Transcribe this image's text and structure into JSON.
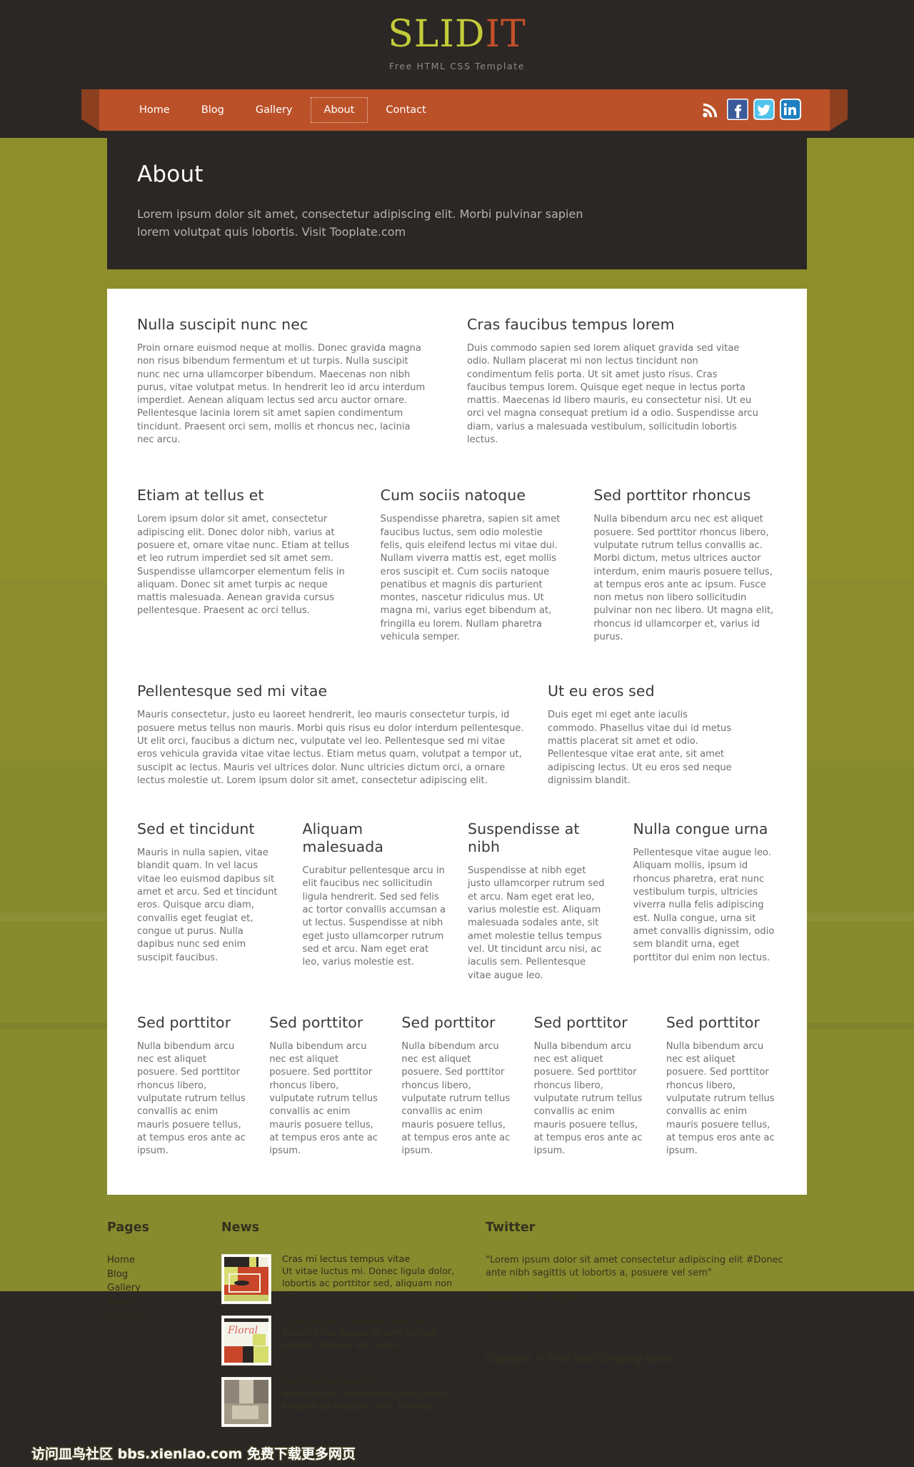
{
  "header": {
    "logo_part_a": "SLID",
    "logo_part_b": "IT",
    "tagline": "Free HTML CSS Template"
  },
  "nav": {
    "items": [
      {
        "label": "Home",
        "active": false
      },
      {
        "label": "Blog",
        "active": false
      },
      {
        "label": "Gallery",
        "active": false
      },
      {
        "label": "About",
        "active": true
      },
      {
        "label": "Contact",
        "active": false
      }
    ],
    "social": [
      {
        "name": "rss-icon",
        "label": "RSS"
      },
      {
        "name": "facebook-icon",
        "label": "Facebook"
      },
      {
        "name": "twitter-icon",
        "label": "Twitter"
      },
      {
        "name": "linkedin-icon",
        "label": "LinkedIn"
      }
    ]
  },
  "intro": {
    "title": "About",
    "text": "Lorem ipsum dolor sit amet, consectetur adipiscing elit. Morbi pulvinar sapien lorem volutpat quis lobortis. Visit Tooplate.com"
  },
  "row1": [
    {
      "heading": "Nulla suscipit nunc nec",
      "body": "Proin ornare euismod neque at mollis. Donec gravida magna non risus bibendum fermentum et ut turpis. Nulla suscipit nunc nec urna ullamcorper bibendum. Maecenas non nibh purus, vitae volutpat metus. In hendrerit leo id arcu interdum imperdiet. Aenean aliquam lectus sed arcu auctor ornare. Pellentesque lacinia lorem sit amet sapien condimentum tincidunt. Praesent orci sem, mollis et rhoncus nec, lacinia nec arcu."
    },
    {
      "heading": "Cras faucibus tempus lorem",
      "body": "Duis commodo sapien sed lorem aliquet gravida sed vitae odio. Nullam placerat mi non lectus tincidunt non condimentum felis porta. Ut sit amet justo risus. Cras faucibus tempus lorem. Quisque eget neque in lectus porta mattis. Maecenas id libero mauris, eu consectetur nisi. Ut eu orci vel magna consequat pretium id a odio. Suspendisse arcu diam, varius a malesuada vestibulum, sollicitudin lobortis lectus."
    }
  ],
  "row2": [
    {
      "heading": "Etiam at tellus et",
      "body": "Lorem ipsum dolor sit amet, consectetur adipiscing elit. Donec dolor nibh, varius at posuere et, ornare vitae nunc. Etiam at tellus et leo rutrum imperdiet sed sit amet sem. Suspendisse ullamcorper elementum felis in aliquam. Donec sit amet turpis ac neque mattis malesuada. Aenean gravida cursus pellentesque. Praesent ac orci tellus."
    },
    {
      "heading": "Cum sociis natoque",
      "body": "Suspendisse pharetra, sapien sit amet faucibus luctus, sem odio molestie felis, quis eleifend lectus mi vitae dui. Nullam viverra mattis est, eget mollis eros suscipit et. Cum sociis natoque penatibus et magnis dis parturient montes, nascetur ridiculus mus. Ut magna mi, varius eget bibendum at, fringilla eu lorem. Nullam pharetra vehicula semper."
    },
    {
      "heading": "Sed porttitor rhoncus",
      "body": "Nulla bibendum arcu nec est aliquet posuere. Sed porttitor rhoncus libero, vulputate rutrum tellus convallis ac. Morbi dictum, metus ultrices auctor interdum, enim mauris posuere tellus, at tempus eros ante ac ipsum. Fusce non metus non libero sollicitudin pulvinar non nec libero. Ut magna elit, rhoncus id ullamcorper et, varius id purus."
    }
  ],
  "row3": [
    {
      "heading": "Pellentesque sed mi vitae",
      "body": "Mauris consectetur, justo eu laoreet hendrerit, leo mauris consectetur turpis, id posuere metus tellus non mauris. Morbi quis risus eu dolor interdum pellentesque. Ut elit orci, faucibus a dictum nec, vulputate vel leo. Pellentesque sed mi vitae eros vehicula gravida vitae vitae lectus. Etiam metus quam, volutpat a tempor ut, suscipit ac lectus. Mauris vel ultrices dolor. Nunc ultricies dictum orci, a ornare lectus molestie ut. Lorem ipsum dolor sit amet, consectetur adipiscing elit."
    },
    {
      "heading": "Ut eu eros sed",
      "body": "Duis eget mi eget ante iaculis commodo. Phasellus vitae dui id metus mattis placerat sit amet et odio. Pellentesque vitae erat ante, sit amet adipiscing lectus. Ut eu eros sed neque dignissim blandit."
    }
  ],
  "row4": [
    {
      "heading": "Sed et tincidunt",
      "body": "Mauris in nulla sapien, vitae blandit quam. In vel lacus vitae leo euismod dapibus sit amet et arcu. Sed et tincidunt eros. Quisque arcu diam, convallis eget feugiat et, congue ut purus. Nulla dapibus nunc sed enim suscipit faucibus."
    },
    {
      "heading": "Aliquam malesuada",
      "body": "Curabitur pellentesque arcu in elit faucibus nec sollicitudin ligula hendrerit. Sed sed felis ac tortor convallis accumsan a ut lectus. Suspendisse at nibh eget justo ullamcorper rutrum sed et arcu. Nam eget erat leo, varius molestie est."
    },
    {
      "heading": "Suspendisse at nibh",
      "body": "Suspendisse at nibh eget justo ullamcorper rutrum sed et arcu. Nam eget erat leo, varius molestie est. Aliquam malesuada sodales ante, sit amet molestie tellus tempus vel. Ut tincidunt arcu nisi, ac iaculis sem. Pellentesque vitae augue leo."
    },
    {
      "heading": "Nulla congue urna",
      "body": "Pellentesque vitae augue leo. Aliquam mollis, ipsum id rhoncus pharetra, erat nunc vestibulum turpis, ultricies viverra nulla felis adipiscing est. Nulla congue, urna sit amet convallis dignissim, odio sem blandit urna, eget porttitor dui enim non lectus."
    }
  ],
  "row5": [
    {
      "heading": "Sed porttitor",
      "body": "Nulla bibendum arcu nec est aliquet posuere. Sed porttitor rhoncus libero, vulputate rutrum tellus convallis ac enim mauris posuere tellus, at tempus eros ante ac ipsum."
    },
    {
      "heading": "Sed porttitor",
      "body": "Nulla bibendum arcu nec est aliquet posuere. Sed porttitor rhoncus libero, vulputate rutrum tellus convallis ac enim mauris posuere tellus, at tempus eros ante ac ipsum."
    },
    {
      "heading": "Sed porttitor",
      "body": "Nulla bibendum arcu nec est aliquet posuere. Sed porttitor rhoncus libero, vulputate rutrum tellus convallis ac enim mauris posuere tellus, at tempus eros ante ac ipsum."
    },
    {
      "heading": "Sed porttitor",
      "body": "Nulla bibendum arcu nec est aliquet posuere. Sed porttitor rhoncus libero, vulputate rutrum tellus convallis ac enim mauris posuere tellus, at tempus eros ante ac ipsum."
    },
    {
      "heading": "Sed porttitor",
      "body": "Nulla bibendum arcu nec est aliquet posuere. Sed porttitor rhoncus libero, vulputate rutrum tellus convallis ac enim mauris posuere tellus, at tempus eros ante ac ipsum."
    }
  ],
  "footer": {
    "pages_title": "Pages",
    "pages": [
      {
        "label": "Home"
      },
      {
        "label": "Blog"
      },
      {
        "label": "Gallery"
      },
      {
        "label": "About"
      },
      {
        "label": "Contact"
      }
    ],
    "news_title": "News",
    "news": [
      {
        "title": "Cras mi lectus tempus vitae",
        "text": "Ut vitae luctus mi. Donec ligula dolor, lobortis ac porttitor sed, aliquam non orci."
      },
      {
        "title": "Cras dignissim volutpat sem id",
        "text": "Donec vitae augue ut sem cursus aliquet rhoncus vel quam."
      },
      {
        "title": "Sed euismod dolor eu",
        "text": "Nulla facilisi. Vestibulum urna libero, fringilla eu faucibus nec, fringilla"
      }
    ],
    "twitter_title": "Twitter",
    "twitter_quote": "\"Lorem ipsum dolor sit amet consectetur adipiscing elit #Donec ante nibh sagittis ut lobortis a, posuere vel sem\"",
    "twitter_follow": "Follow me on Twitter",
    "copyright": "Copyright © 2048 Your Company Name"
  },
  "watermark": {
    "text": "访问皿鸟社区 bbs.xienlao.com 免费下载更多网页"
  },
  "colors": {
    "dark": "#2b2724",
    "olive": "#8d8f2b",
    "orange": "#bb5129",
    "logo_green": "#c3cb3a",
    "logo_orange": "#c4502a"
  }
}
